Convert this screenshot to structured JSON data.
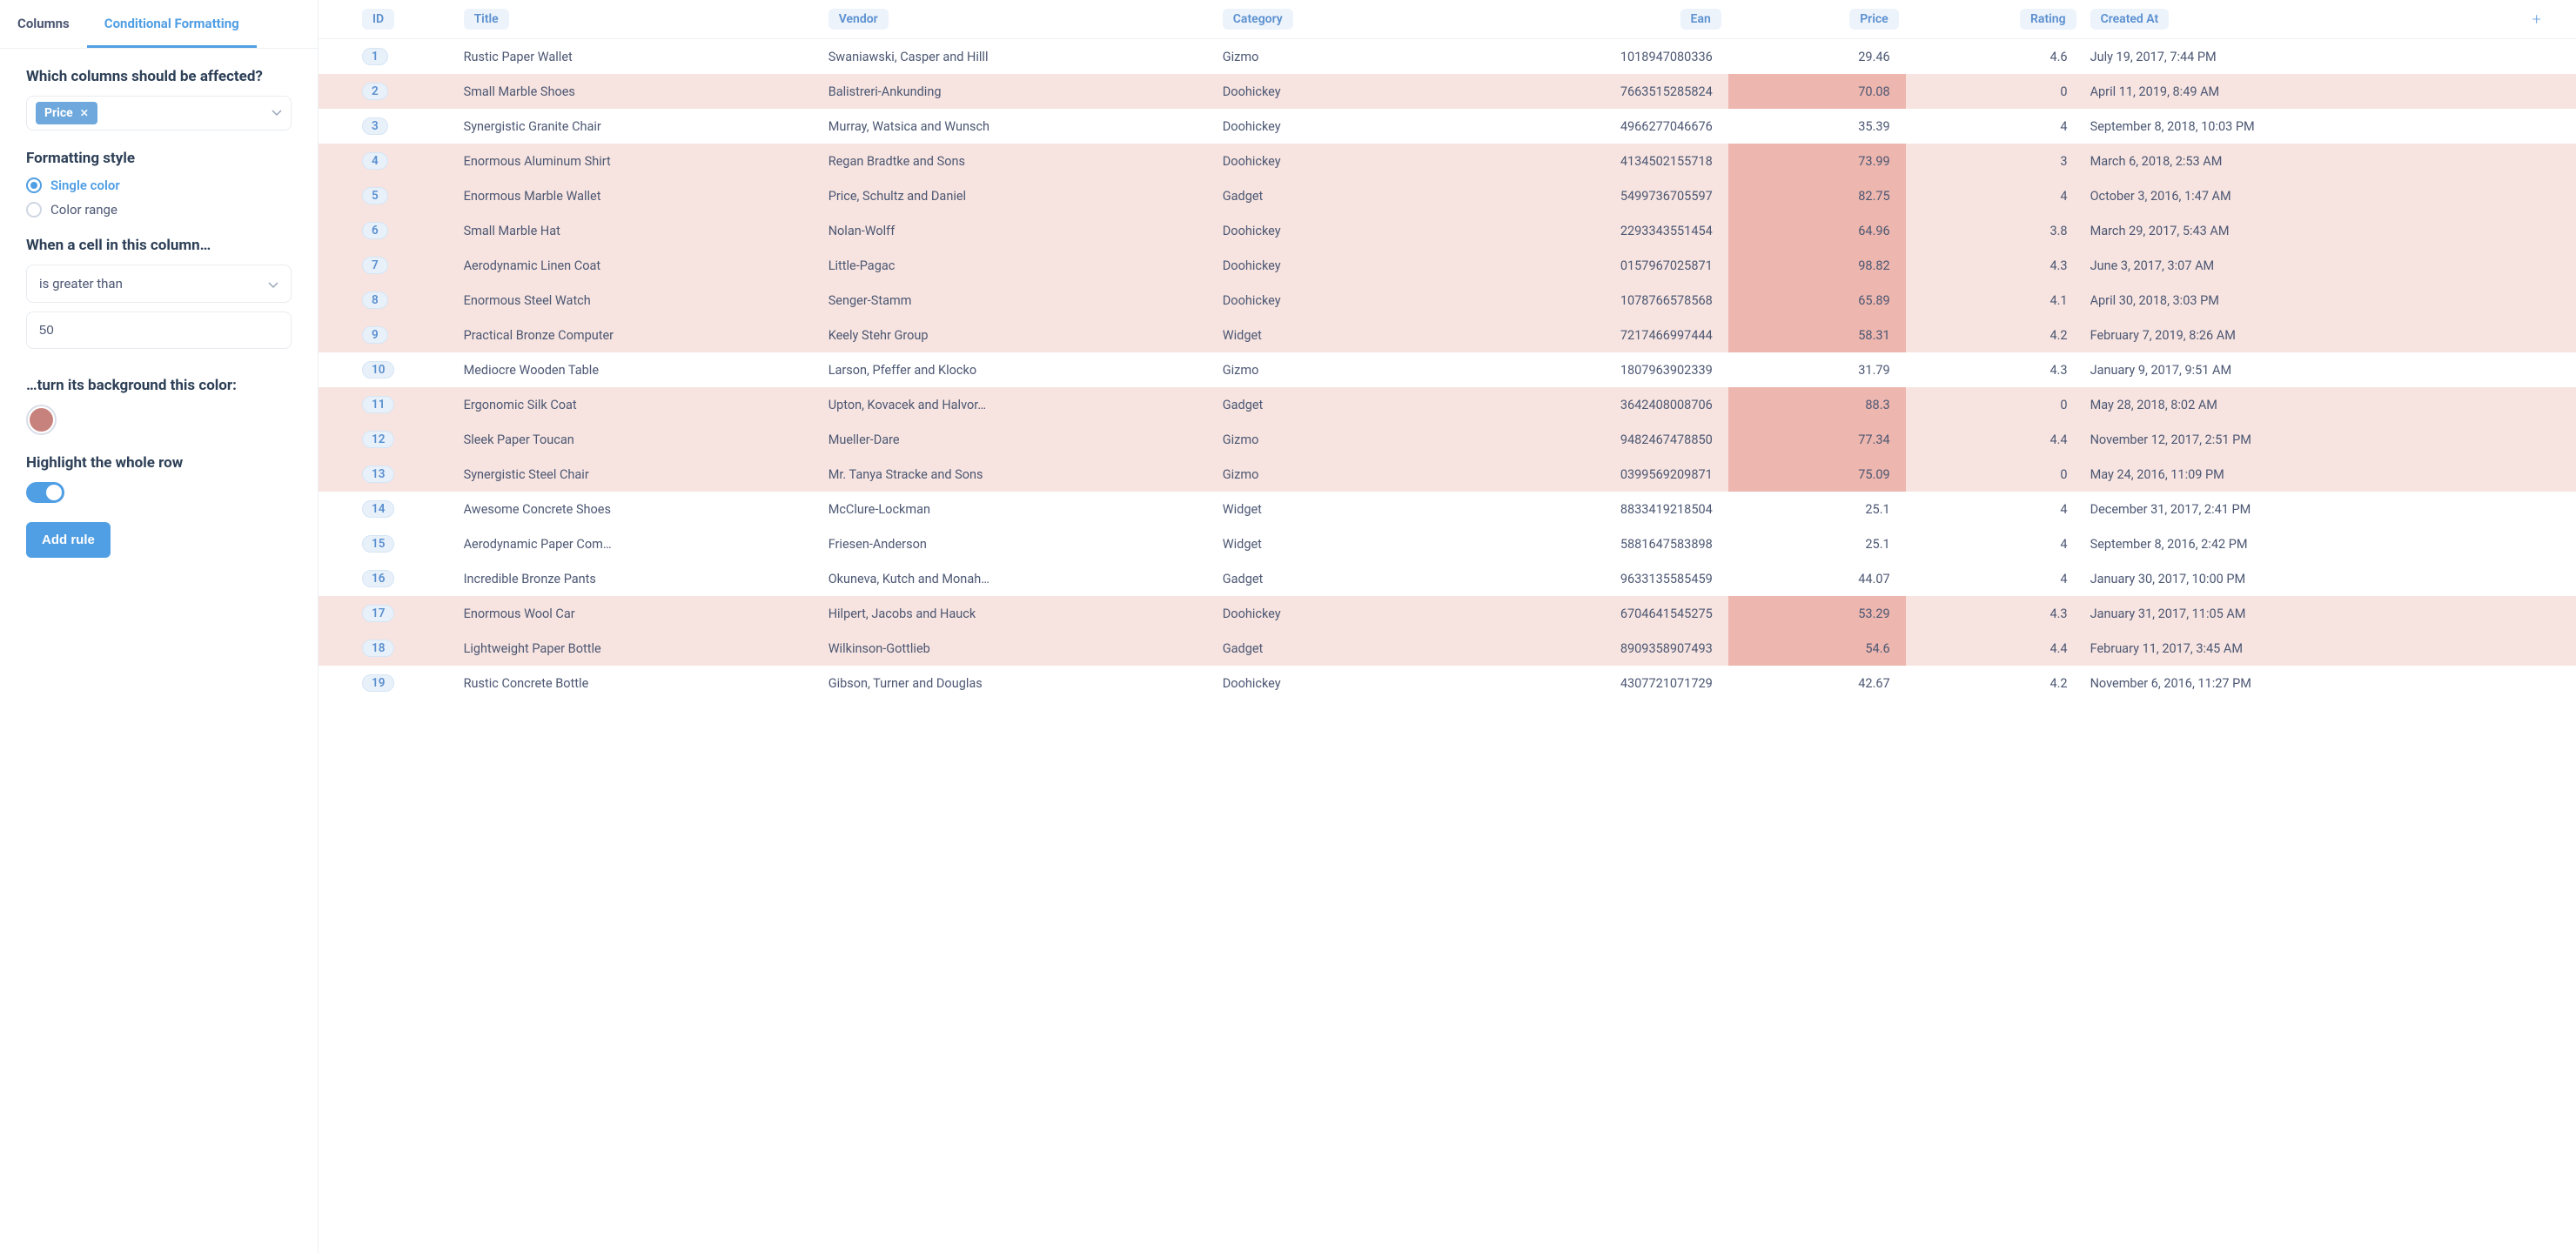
{
  "tabs": [
    {
      "label": "Columns",
      "active": false
    },
    {
      "label": "Conditional Formatting",
      "active": true
    }
  ],
  "panel": {
    "columns_label": "Which columns should be affected?",
    "selected_column": "Price",
    "style_label": "Formatting style",
    "style_options": [
      {
        "label": "Single color",
        "checked": true
      },
      {
        "label": "Color range",
        "checked": false
      }
    ],
    "condition_label": "When a cell in this column…",
    "operator": "is greater than",
    "value": "50",
    "color_label": "…turn its background this color:",
    "swatch_color": "#c8827d",
    "highlight_row_label": "Highlight the whole row",
    "highlight_row_on": true,
    "add_rule": "Add rule"
  },
  "columns": [
    "ID",
    "Title",
    "Vendor",
    "Category",
    "Ean",
    "Price",
    "Rating",
    "Created At"
  ],
  "condition_threshold": 50,
  "rows": [
    {
      "id": 1,
      "title": "Rustic Paper Wallet",
      "vendor": "Swaniawski, Casper and Hilll",
      "category": "Gizmo",
      "ean": "1018947080336",
      "price": 29.46,
      "rating": "4.6",
      "created": "July 19, 2017, 7:44 PM"
    },
    {
      "id": 2,
      "title": "Small Marble Shoes",
      "vendor": "Balistreri-Ankunding",
      "category": "Doohickey",
      "ean": "7663515285824",
      "price": 70.08,
      "rating": "0",
      "created": "April 11, 2019, 8:49 AM"
    },
    {
      "id": 3,
      "title": "Synergistic Granite Chair",
      "vendor": "Murray, Watsica and Wunsch",
      "category": "Doohickey",
      "ean": "4966277046676",
      "price": 35.39,
      "rating": "4",
      "created": "September 8, 2018, 10:03 PM"
    },
    {
      "id": 4,
      "title": "Enormous Aluminum Shirt",
      "vendor": "Regan Bradtke and Sons",
      "category": "Doohickey",
      "ean": "4134502155718",
      "price": 73.99,
      "rating": "3",
      "created": "March 6, 2018, 2:53 AM"
    },
    {
      "id": 5,
      "title": "Enormous Marble Wallet",
      "vendor": "Price, Schultz and Daniel",
      "category": "Gadget",
      "ean": "5499736705597",
      "price": 82.75,
      "rating": "4",
      "created": "October 3, 2016, 1:47 AM"
    },
    {
      "id": 6,
      "title": "Small Marble Hat",
      "vendor": "Nolan-Wolff",
      "category": "Doohickey",
      "ean": "2293343551454",
      "price": 64.96,
      "rating": "3.8",
      "created": "March 29, 2017, 5:43 AM"
    },
    {
      "id": 7,
      "title": "Aerodynamic Linen Coat",
      "vendor": "Little-Pagac",
      "category": "Doohickey",
      "ean": "0157967025871",
      "price": 98.82,
      "rating": "4.3",
      "created": "June 3, 2017, 3:07 AM"
    },
    {
      "id": 8,
      "title": "Enormous Steel Watch",
      "vendor": "Senger-Stamm",
      "category": "Doohickey",
      "ean": "1078766578568",
      "price": 65.89,
      "rating": "4.1",
      "created": "April 30, 2018, 3:03 PM"
    },
    {
      "id": 9,
      "title": "Practical Bronze Computer",
      "vendor": "Keely Stehr Group",
      "category": "Widget",
      "ean": "7217466997444",
      "price": 58.31,
      "rating": "4.2",
      "created": "February 7, 2019, 8:26 AM"
    },
    {
      "id": 10,
      "title": "Mediocre Wooden Table",
      "vendor": "Larson, Pfeffer and Klocko",
      "category": "Gizmo",
      "ean": "1807963902339",
      "price": 31.79,
      "rating": "4.3",
      "created": "January 9, 2017, 9:51 AM"
    },
    {
      "id": 11,
      "title": "Ergonomic Silk Coat",
      "vendor": "Upton, Kovacek and Halvor…",
      "category": "Gadget",
      "ean": "3642408008706",
      "price": 88.3,
      "rating": "0",
      "created": "May 28, 2018, 8:02 AM"
    },
    {
      "id": 12,
      "title": "Sleek Paper Toucan",
      "vendor": "Mueller-Dare",
      "category": "Gizmo",
      "ean": "9482467478850",
      "price": 77.34,
      "rating": "4.4",
      "created": "November 12, 2017, 2:51 PM"
    },
    {
      "id": 13,
      "title": "Synergistic Steel Chair",
      "vendor": "Mr. Tanya Stracke and Sons",
      "category": "Gizmo",
      "ean": "0399569209871",
      "price": 75.09,
      "rating": "0",
      "created": "May 24, 2016, 11:09 PM"
    },
    {
      "id": 14,
      "title": "Awesome Concrete Shoes",
      "vendor": "McClure-Lockman",
      "category": "Widget",
      "ean": "8833419218504",
      "price": 25.1,
      "rating": "4",
      "created": "December 31, 2017, 2:41 PM"
    },
    {
      "id": 15,
      "title": "Aerodynamic Paper Com…",
      "vendor": "Friesen-Anderson",
      "category": "Widget",
      "ean": "5881647583898",
      "price": 25.1,
      "rating": "4",
      "created": "September 8, 2016, 2:42 PM"
    },
    {
      "id": 16,
      "title": "Incredible Bronze Pants",
      "vendor": "Okuneva, Kutch and Monah…",
      "category": "Gadget",
      "ean": "9633135585459",
      "price": 44.07,
      "rating": "4",
      "created": "January 30, 2017, 10:00 PM"
    },
    {
      "id": 17,
      "title": "Enormous Wool Car",
      "vendor": "Hilpert, Jacobs and Hauck",
      "category": "Doohickey",
      "ean": "6704641545275",
      "price": 53.29,
      "rating": "4.3",
      "created": "January 31, 2017, 11:05 AM"
    },
    {
      "id": 18,
      "title": "Lightweight Paper Bottle",
      "vendor": "Wilkinson-Gottlieb",
      "category": "Gadget",
      "ean": "8909358907493",
      "price": 54.6,
      "rating": "4.4",
      "created": "February 11, 2017, 3:45 AM"
    },
    {
      "id": 19,
      "title": "Rustic Concrete Bottle",
      "vendor": "Gibson, Turner and Douglas",
      "category": "Doohickey",
      "ean": "4307721071729",
      "price": 42.67,
      "rating": "4.2",
      "created": "November 6, 2016, 11:27 PM"
    }
  ]
}
